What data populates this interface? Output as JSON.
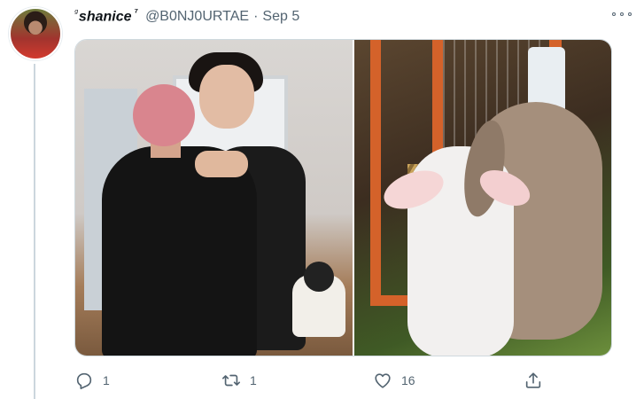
{
  "tweet": {
    "author": {
      "name_prefix": "ᵍ",
      "display_name": "shanice",
      "name_suffix": "⁷",
      "handle": "@B0NJ0URTAE",
      "separator": "·",
      "date": "Sep 5"
    },
    "media": [
      {
        "subject": "two people hugging"
      },
      {
        "subject": "two rabbits hugging"
      }
    ],
    "actions": {
      "reply_count": "1",
      "retweet_count": "1",
      "like_count": "16",
      "share_count": ""
    }
  },
  "icons": {
    "reply": "reply-icon",
    "retweet": "retweet-icon",
    "like": "heart-icon",
    "share": "share-icon",
    "more": "more-horizontal-icon"
  },
  "colors": {
    "text_primary": "#0f1419",
    "text_secondary": "#536471",
    "thread_line": "#ccd6dd",
    "border": "#cfd9de"
  }
}
